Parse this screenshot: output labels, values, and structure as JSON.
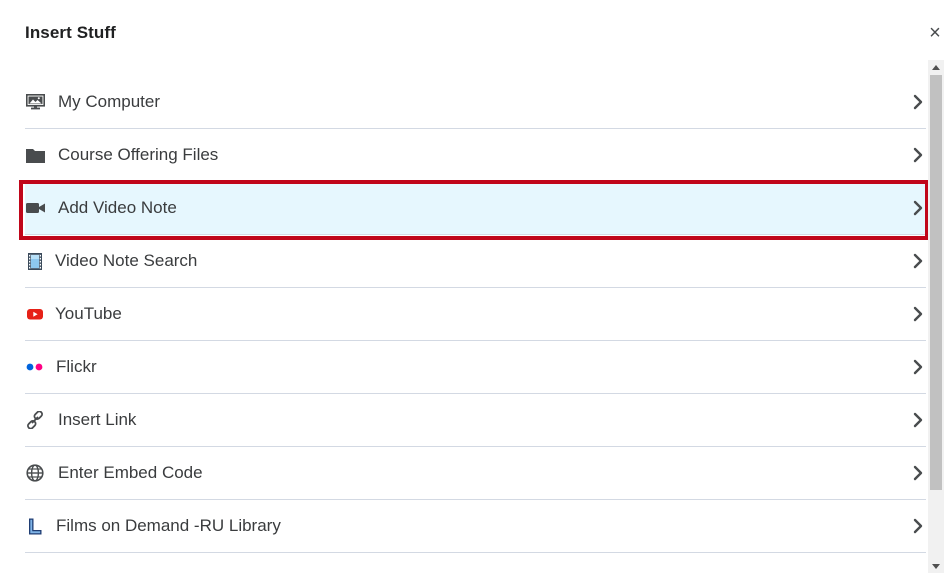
{
  "dialog": {
    "title": "Insert Stuff",
    "close_glyph": "×"
  },
  "items": [
    {
      "label": "My Computer",
      "icon": "computer-icon"
    },
    {
      "label": "Course Offering Files",
      "icon": "folder-icon"
    },
    {
      "label": "Add Video Note",
      "icon": "video-camera-icon",
      "highlighted": true
    },
    {
      "label": "Video Note Search",
      "icon": "film-icon"
    },
    {
      "label": "YouTube",
      "icon": "youtube-icon"
    },
    {
      "label": "Flickr",
      "icon": "flickr-icon"
    },
    {
      "label": "Insert Link",
      "icon": "link-icon"
    },
    {
      "label": "Enter Embed Code",
      "icon": "globe-icon"
    },
    {
      "label": "Films on Demand -RU Library",
      "icon": "films-on-demand-icon"
    }
  ],
  "colors": {
    "highlight_border": "#c0061a",
    "highlight_fill": "#e6f7fe",
    "divider": "#d3d9e3",
    "youtube_red": "#e62117",
    "flickr_blue": "#0063dc",
    "flickr_pink": "#ff0084"
  }
}
